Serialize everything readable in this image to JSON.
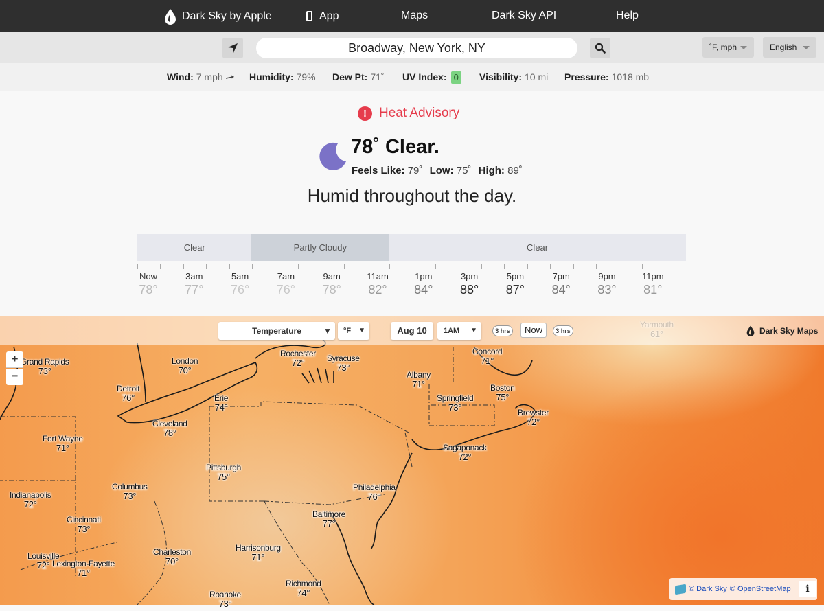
{
  "nav": {
    "brand": "Dark Sky by Apple",
    "app": "App",
    "maps": "Maps",
    "api": "Dark Sky API",
    "help": "Help"
  },
  "search": {
    "location": "Broadway, New York, NY",
    "units": "˚F, mph",
    "language": "English"
  },
  "stats": {
    "wind_label": "Wind:",
    "wind_value": "7 mph",
    "humidity_label": "Humidity:",
    "humidity_value": "79%",
    "dew_label": "Dew Pt:",
    "dew_value": "71˚",
    "uv_label": "UV Index:",
    "uv_value": "0",
    "visibility_label": "Visibility:",
    "visibility_value": "10 mi",
    "pressure_label": "Pressure:",
    "pressure_value": "1018 mb"
  },
  "current": {
    "alert": "Heat Advisory",
    "headline": "78˚ Clear.",
    "feels_label": "Feels Like:",
    "feels_value": "79˚",
    "low_label": "Low:",
    "low_value": "75˚",
    "high_label": "High:",
    "high_value": "89˚",
    "summary": "Humid throughout the day."
  },
  "timeline": {
    "segments": [
      {
        "label": "Clear",
        "hours": 5,
        "type": "clear"
      },
      {
        "label": "Partly Cloudy",
        "hours": 6,
        "type": "partly"
      },
      {
        "label": "Clear",
        "hours": 13,
        "type": "clear"
      }
    ],
    "hours": [
      {
        "label": "Now",
        "temp": "78°",
        "color": "#bbbbbb"
      },
      {
        "label": "3am",
        "temp": "77°",
        "color": "#bbbbbb"
      },
      {
        "label": "5am",
        "temp": "76°",
        "color": "#c8c8c8"
      },
      {
        "label": "7am",
        "temp": "76°",
        "color": "#c8c8c8"
      },
      {
        "label": "9am",
        "temp": "78°",
        "color": "#bbbbbb"
      },
      {
        "label": "11am",
        "temp": "82°",
        "color": "#999999"
      },
      {
        "label": "1pm",
        "temp": "84°",
        "color": "#777777"
      },
      {
        "label": "3pm",
        "temp": "88°",
        "color": "#222222"
      },
      {
        "label": "5pm",
        "temp": "87°",
        "color": "#333333"
      },
      {
        "label": "7pm",
        "temp": "84°",
        "color": "#777777"
      },
      {
        "label": "9pm",
        "temp": "83°",
        "color": "#888888"
      },
      {
        "label": "11pm",
        "temp": "81°",
        "color": "#9a9a9a"
      }
    ]
  },
  "map": {
    "layer": "Temperature",
    "unit": "°F",
    "date": "Aug 10",
    "time": "1AM",
    "back": "3 hrs",
    "now": "Now",
    "forward": "3 hrs",
    "brand": "Dark Sky Maps",
    "zoom_in": "+",
    "zoom_out": "−",
    "attrib_darksky": "© Dark Sky",
    "attrib_osm": "© OpenStreetMap",
    "info": "i",
    "cities": [
      {
        "name": "Grand Rapids",
        "temp": "73°"
      },
      {
        "name": "London",
        "temp": "70°"
      },
      {
        "name": "Rochester",
        "temp": "72°"
      },
      {
        "name": "Syracuse",
        "temp": "73°"
      },
      {
        "name": "Concord",
        "temp": "71°"
      },
      {
        "name": "Detroit",
        "temp": "76°"
      },
      {
        "name": "Albany",
        "temp": "71°"
      },
      {
        "name": "Boston",
        "temp": "75°"
      },
      {
        "name": "Erie",
        "temp": "74°"
      },
      {
        "name": "Springfield",
        "temp": "73°"
      },
      {
        "name": "Brewster",
        "temp": "72°"
      },
      {
        "name": "Cleveland",
        "temp": "78°"
      },
      {
        "name": "Fort Wayne",
        "temp": "71°"
      },
      {
        "name": "Sagaponack",
        "temp": "72°"
      },
      {
        "name": "Pittsburgh",
        "temp": "75°"
      },
      {
        "name": "Columbus",
        "temp": "73°"
      },
      {
        "name": "Philadelphia",
        "temp": "76°"
      },
      {
        "name": "Indianapolis",
        "temp": "72°"
      },
      {
        "name": "Baltimore",
        "temp": "77°"
      },
      {
        "name": "Cincinnati",
        "temp": "73°"
      },
      {
        "name": "Harrisonburg",
        "temp": "71°"
      },
      {
        "name": "Charleston",
        "temp": "70°"
      },
      {
        "name": "Louisville",
        "temp": "72°"
      },
      {
        "name": "Lexington-Fayette",
        "temp": "71°"
      },
      {
        "name": "Richmond",
        "temp": "74°"
      },
      {
        "name": "Roanoke",
        "temp": "73°"
      },
      {
        "name": "Yarmouth",
        "temp": "61°"
      }
    ]
  }
}
